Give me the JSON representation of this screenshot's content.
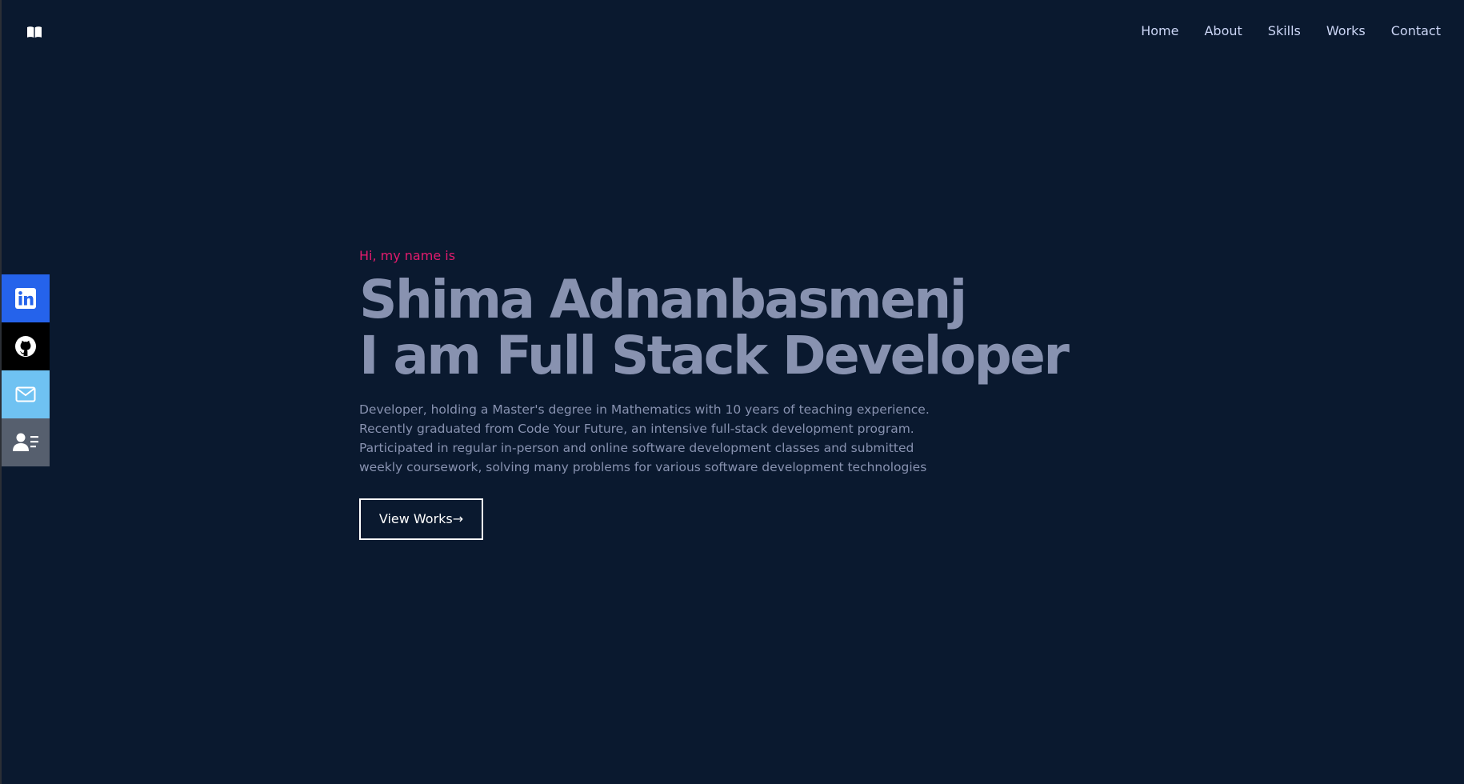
{
  "header": {
    "logo_icon": "book-icon",
    "nav": [
      {
        "label": "Home"
      },
      {
        "label": "About"
      },
      {
        "label": "Skills"
      },
      {
        "label": "Works"
      },
      {
        "label": "Contact"
      }
    ]
  },
  "social": [
    {
      "icon": "linkedin-icon",
      "color": "#2563eb"
    },
    {
      "icon": "github-icon",
      "color": "#000000"
    },
    {
      "icon": "mail-icon",
      "color": "#6fc2f2"
    },
    {
      "icon": "resume-icon",
      "color": "#565f6e"
    }
  ],
  "hero": {
    "greeting": "Hi, my name is",
    "name": "Shima Adnanbasmenj",
    "title": "I am Full Stack Developer",
    "bio": [
      "Developer, holding a Master's degree in Mathematics with 10 years of teaching experience.",
      "Recently graduated from Code Your Future, an intensive full-stack development program.",
      "Participated in regular in-person and online software development classes and submitted",
      "weekly coursework, solving many problems for various software development technologies"
    ],
    "cta_label": "View Works→"
  },
  "colors": {
    "background": "#0a192f",
    "accent": "#e31b6d",
    "text_muted": "#8892b0",
    "nav_text": "#ccd6f6"
  }
}
